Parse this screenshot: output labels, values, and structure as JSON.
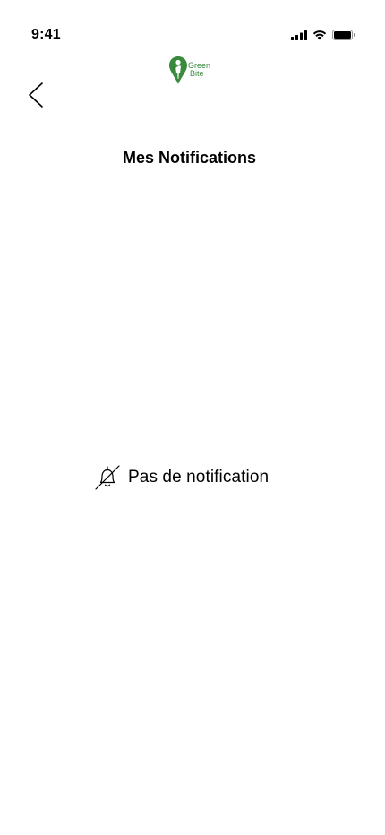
{
  "status_bar": {
    "time": "9:41",
    "icons": [
      "cellular-signal-icon",
      "wifi-icon",
      "battery-icon"
    ]
  },
  "header": {
    "logo_text_line1": "Green",
    "logo_text_line2": "Bite",
    "back_icon": "chevron-left-icon",
    "title": "Mes Notifications"
  },
  "empty_state": {
    "icon": "bell-off-icon",
    "text": "Pas de notification"
  },
  "colors": {
    "brand_green": "#3a8a3e",
    "text": "#000000",
    "background": "#ffffff"
  }
}
